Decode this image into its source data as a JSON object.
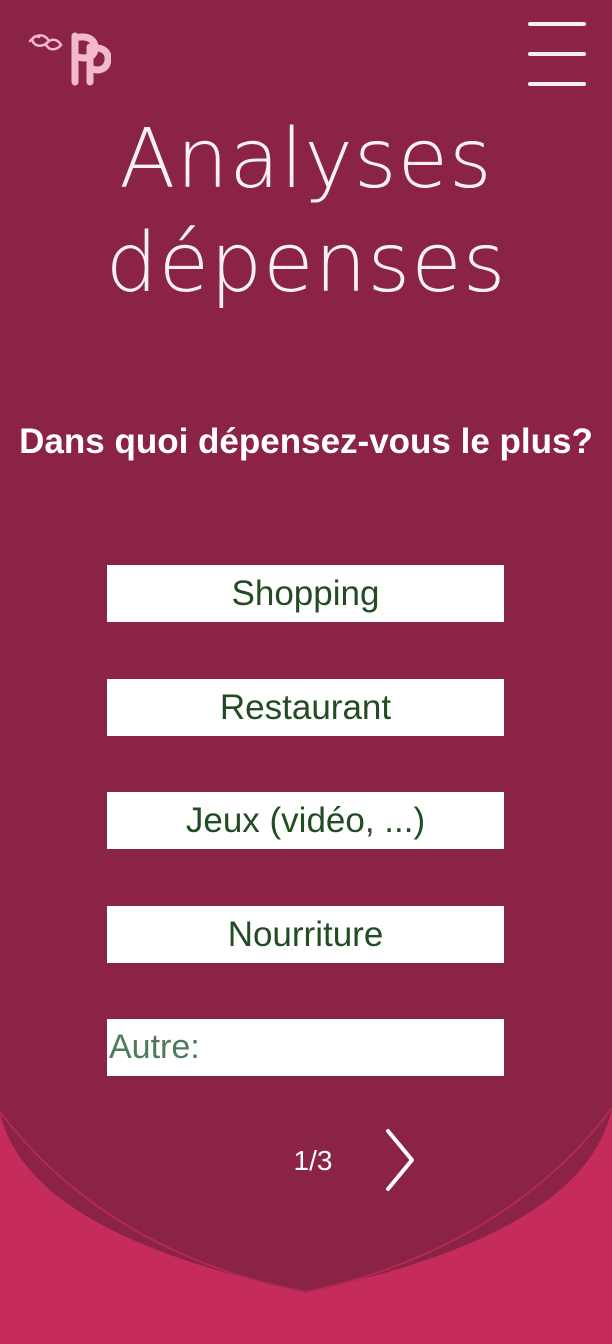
{
  "header": {
    "logo_icon": "pp-logo-icon",
    "menu_icon": "hamburger-menu-icon"
  },
  "main": {
    "title_line1": "Analyses",
    "title_line2": "dépenses",
    "question": "Dans quoi dépensez-vous le plus?",
    "options": [
      {
        "label": "Shopping"
      },
      {
        "label": "Restaurant"
      },
      {
        "label": "Jeux (vidéo, ...)"
      },
      {
        "label": "Nourriture"
      }
    ],
    "other_label": "Autre:"
  },
  "pagination": {
    "counter": "1/3",
    "next_icon": "chevron-right-icon"
  },
  "colors": {
    "background": "#8a2345",
    "wave": "#c52c5b",
    "button_bg": "#ffffff",
    "button_text": "#234c23",
    "logo_pink": "#f2b8ce"
  }
}
